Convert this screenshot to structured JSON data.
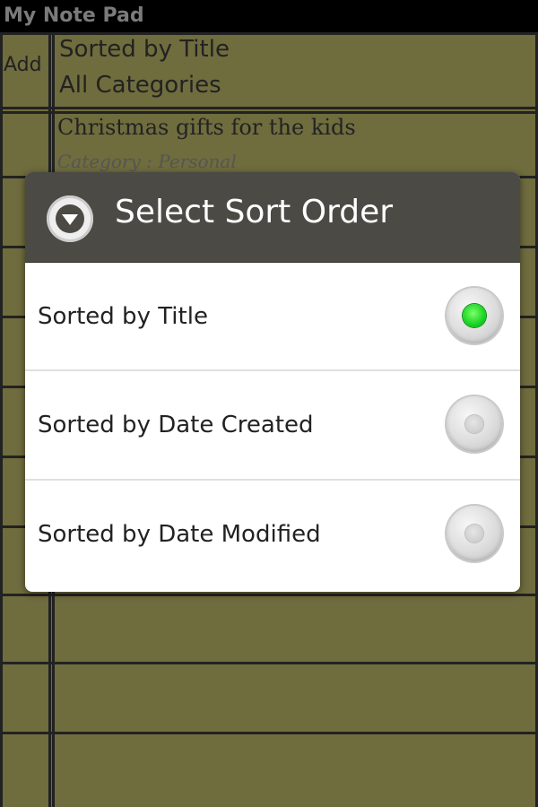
{
  "app": {
    "title": "My Note Pad",
    "add_label": "Add",
    "sort_label": "Sorted by Title",
    "category_filter": "All Categories",
    "notes": [
      {
        "title": "Christmas gifts for the kids",
        "category": "Category : Personal"
      }
    ]
  },
  "dialog": {
    "title": "Select Sort Order",
    "icon": "chevron-down-circle-icon",
    "selected": 0,
    "options": [
      {
        "label": "Sorted by Title",
        "checked": true
      },
      {
        "label": "Sorted by Date Created",
        "checked": false
      },
      {
        "label": "Sorted by Date Modified",
        "checked": false
      }
    ]
  },
  "colors": {
    "app_background": "#6f6c3e",
    "grid_lines": "#222222",
    "dialog_header": "#4c4a45",
    "radio_selected": "#18d322"
  }
}
